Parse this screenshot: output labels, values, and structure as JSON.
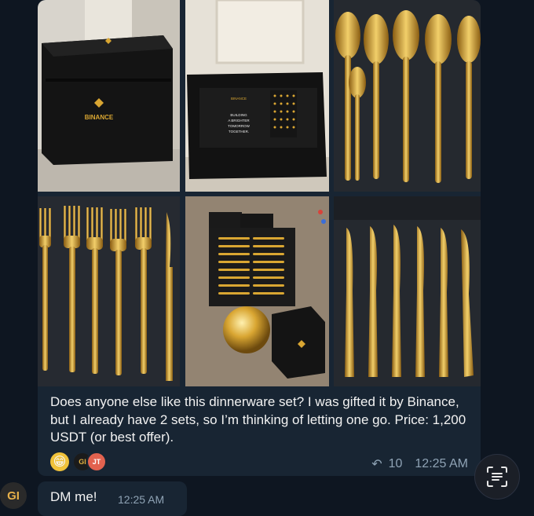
{
  "message": {
    "text": "Does anyone else like this dinnerware set? I was gifted it by Binance, but I already have 2 sets, so I’m thinking of letting one go. Price: 1,200 USDT (or best offer).",
    "reactions": {
      "emoji": "😁",
      "avatar_a": "GI",
      "avatar_b": "JT"
    },
    "forward_count": "10",
    "time": "12:25 AM",
    "photos": [
      {
        "name": "photo-black-box",
        "box_label": "BINANCE"
      },
      {
        "name": "photo-open-box",
        "card_lines": [
          "BINANCE",
          "BUILDING",
          "A BRIGHTER",
          "TOMORROW",
          "TOGETHER."
        ]
      },
      {
        "name": "photo-spoons"
      },
      {
        "name": "photo-forks"
      },
      {
        "name": "photo-full-set"
      },
      {
        "name": "photo-knives"
      }
    ]
  },
  "reply": {
    "text": "DM me!",
    "time": "12:25 AM"
  },
  "sender": {
    "initials": "GI"
  },
  "icons": {
    "reply": "reply-arrow-icon",
    "lens": "text-recognition-icon"
  },
  "colors": {
    "background": "#0e1621",
    "bubble": "#182533",
    "meta_text": "#8fa3b5",
    "gold": "#d9a632"
  }
}
